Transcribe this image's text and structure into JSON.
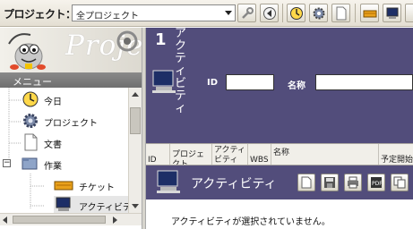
{
  "toolbar": {
    "project_label": "プロジェクト：",
    "project_selected": "全プロジェクト",
    "buttons": [
      "wrench-icon",
      "back-icon",
      "clock-icon",
      "gear-icon",
      "document-icon",
      "ticket-icon",
      "monitor-icon"
    ]
  },
  "logo": {
    "text": "Proje"
  },
  "menu": {
    "header": "メニュー",
    "items": [
      {
        "label": "今日",
        "icon": "clock-icon"
      },
      {
        "label": "プロジェクト",
        "icon": "gear-icon"
      },
      {
        "label": "文書",
        "icon": "document-icon"
      },
      {
        "label": "作業",
        "icon": "folder-icon",
        "expander": "−"
      },
      {
        "label": "チケット",
        "icon": "ticket-icon"
      },
      {
        "label": "アクティビテ",
        "icon": "monitor-icon"
      }
    ]
  },
  "activity": {
    "number": "1",
    "title": "アクティビティ",
    "id_label": "ID",
    "id_value": "",
    "name_label": "名称",
    "name_value": ""
  },
  "table": {
    "columns": [
      "ID",
      "プロジェクト",
      "アクティビティ",
      "WBS",
      "名称",
      "予定開始"
    ]
  },
  "detail": {
    "title": "アクティビティ",
    "message": "アクティビティが選択されていません。",
    "buttons": [
      "new-document-icon",
      "save-icon",
      "print-icon",
      "pdf-icon",
      "copy-icon"
    ]
  },
  "colors": {
    "panel": "#524d7b",
    "menu_header": "#7d7d7d"
  }
}
